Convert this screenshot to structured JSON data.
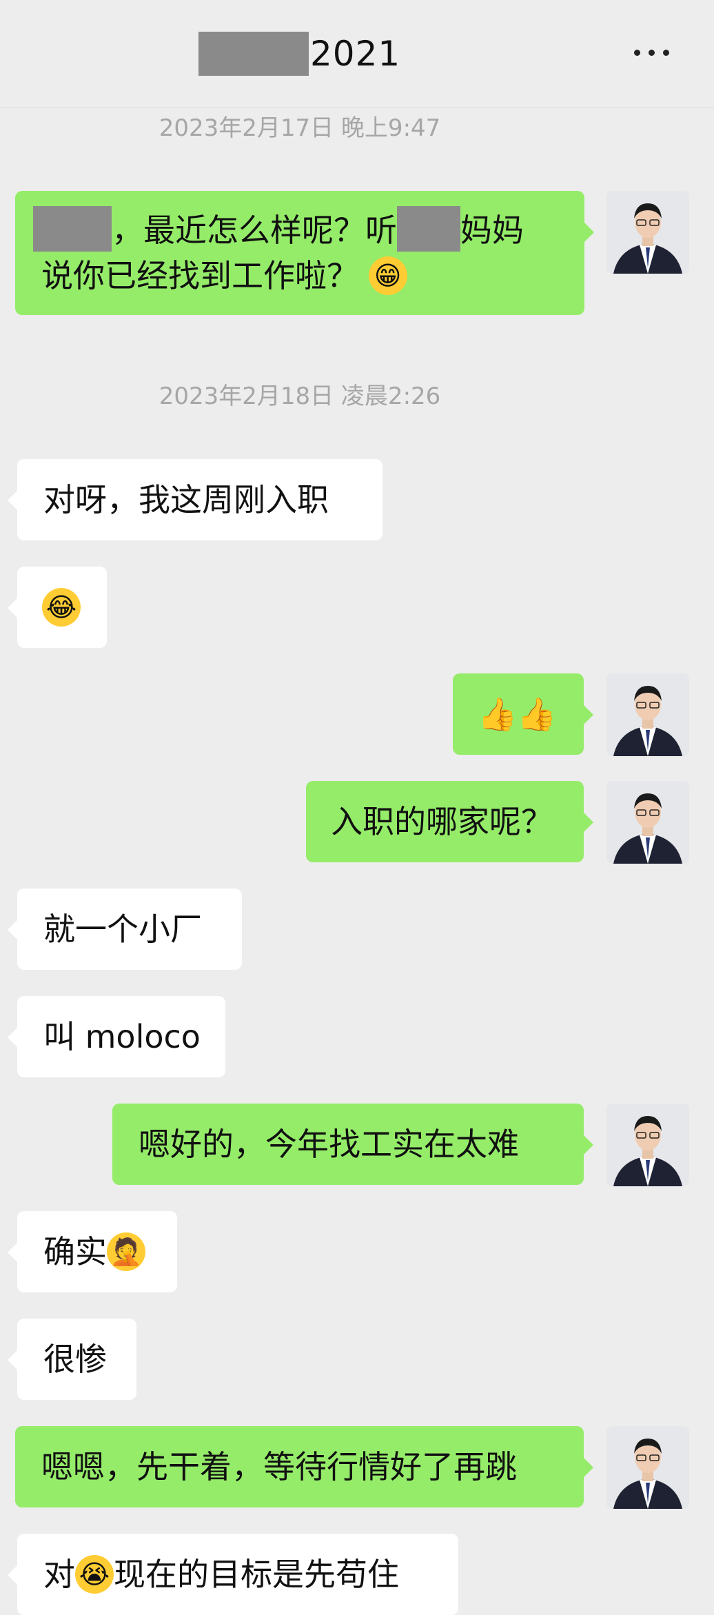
{
  "header": {
    "title_suffix": "2021"
  },
  "timestamps": [
    "2023年2月17日 晚上9:47",
    "2023年2月18日 凌晨2:26"
  ],
  "messages": [
    {
      "side": "sent",
      "line1_mid": "，最近怎么样呢？听",
      "line1_end": "妈妈",
      "line2": "说你已经找到工作啦？"
    },
    {
      "side": "recv",
      "text": "对呀，我这周刚入职"
    },
    {
      "side": "recv",
      "text": ""
    },
    {
      "side": "sent",
      "text": "👍👍"
    },
    {
      "side": "sent",
      "text": "入职的哪家呢？"
    },
    {
      "side": "recv",
      "text": "就一个小厂"
    },
    {
      "side": "recv",
      "text": "叫 moloco"
    },
    {
      "side": "sent",
      "text": "嗯好的，今年找工实在太难"
    },
    {
      "side": "recv",
      "text": "确实"
    },
    {
      "side": "recv",
      "text": "很惨"
    },
    {
      "side": "sent",
      "text": "嗯嗯，先干着，等待行情好了再跳"
    },
    {
      "side": "recv",
      "text_a": "对",
      "text_b": "现在的目标是先苟住"
    }
  ],
  "icons": {
    "more": "more-dots-icon",
    "avatar": "avatar"
  }
}
